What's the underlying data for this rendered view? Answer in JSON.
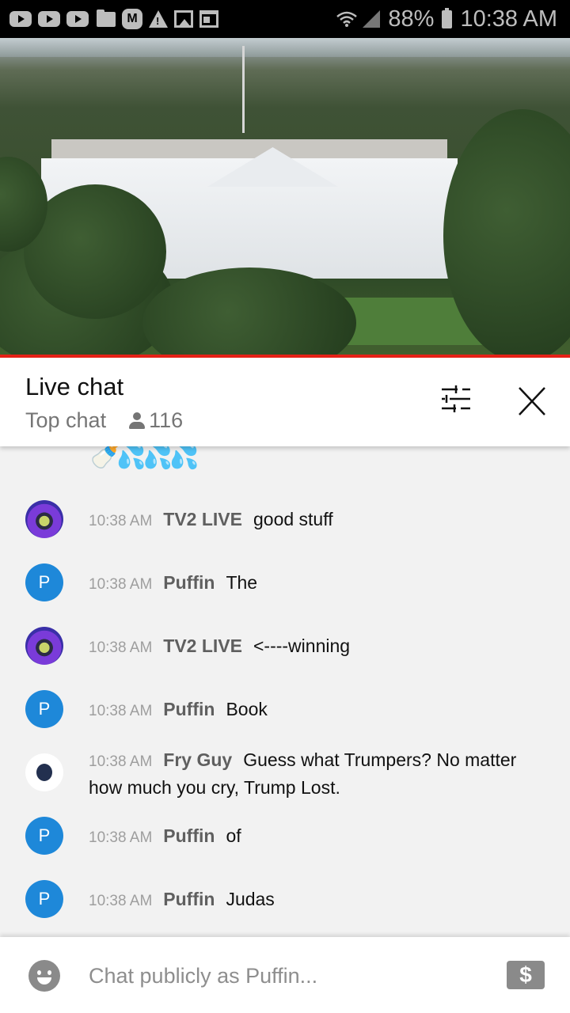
{
  "status_bar": {
    "notification_icons": [
      "youtube-icon",
      "youtube-icon",
      "youtube-icon",
      "folder-icon",
      "m-app-icon",
      "warning-icon",
      "image-icon",
      "news-icon"
    ],
    "battery": "88%",
    "time": "10:38 AM"
  },
  "video": {
    "description": "White House live camera stream",
    "progress_color": "#e62117"
  },
  "chat_header": {
    "title": "Live chat",
    "mode": "Top chat",
    "viewer_count": "116"
  },
  "chat": {
    "partial_emoji": "🍼💦💦💦",
    "messages": [
      {
        "avatar": "tv2-live-avatar",
        "avatar_letter": "",
        "time": "10:38 AM",
        "author": "TV2 LIVE",
        "text": "good stuff"
      },
      {
        "avatar": "letter-avatar",
        "avatar_letter": "P",
        "time": "10:38 AM",
        "author": "Puffin",
        "text": "The"
      },
      {
        "avatar": "tv2-live-avatar",
        "avatar_letter": "",
        "time": "10:38 AM",
        "author": "TV2 LIVE",
        "text": "<----winning"
      },
      {
        "avatar": "letter-avatar",
        "avatar_letter": "P",
        "time": "10:38 AM",
        "author": "Puffin",
        "text": "Book"
      },
      {
        "avatar": "fry-guy-avatar",
        "avatar_letter": "",
        "time": "10:38 AM",
        "author": "Fry Guy",
        "text": "Guess what Trumpers? No matter how much you cry, Trump Lost."
      },
      {
        "avatar": "letter-avatar",
        "avatar_letter": "P",
        "time": "10:38 AM",
        "author": "Puffin",
        "text": "of"
      },
      {
        "avatar": "letter-avatar",
        "avatar_letter": "P",
        "time": "10:38 AM",
        "author": "Puffin",
        "text": "Judas"
      }
    ]
  },
  "input_bar": {
    "placeholder": "Chat publicly as Puffin...",
    "value": "",
    "super_chat_symbol": "$"
  },
  "colors": {
    "avatar_blue": "#1e88d9",
    "accent_red": "#e62117",
    "chat_bg": "#f2f2f2"
  }
}
